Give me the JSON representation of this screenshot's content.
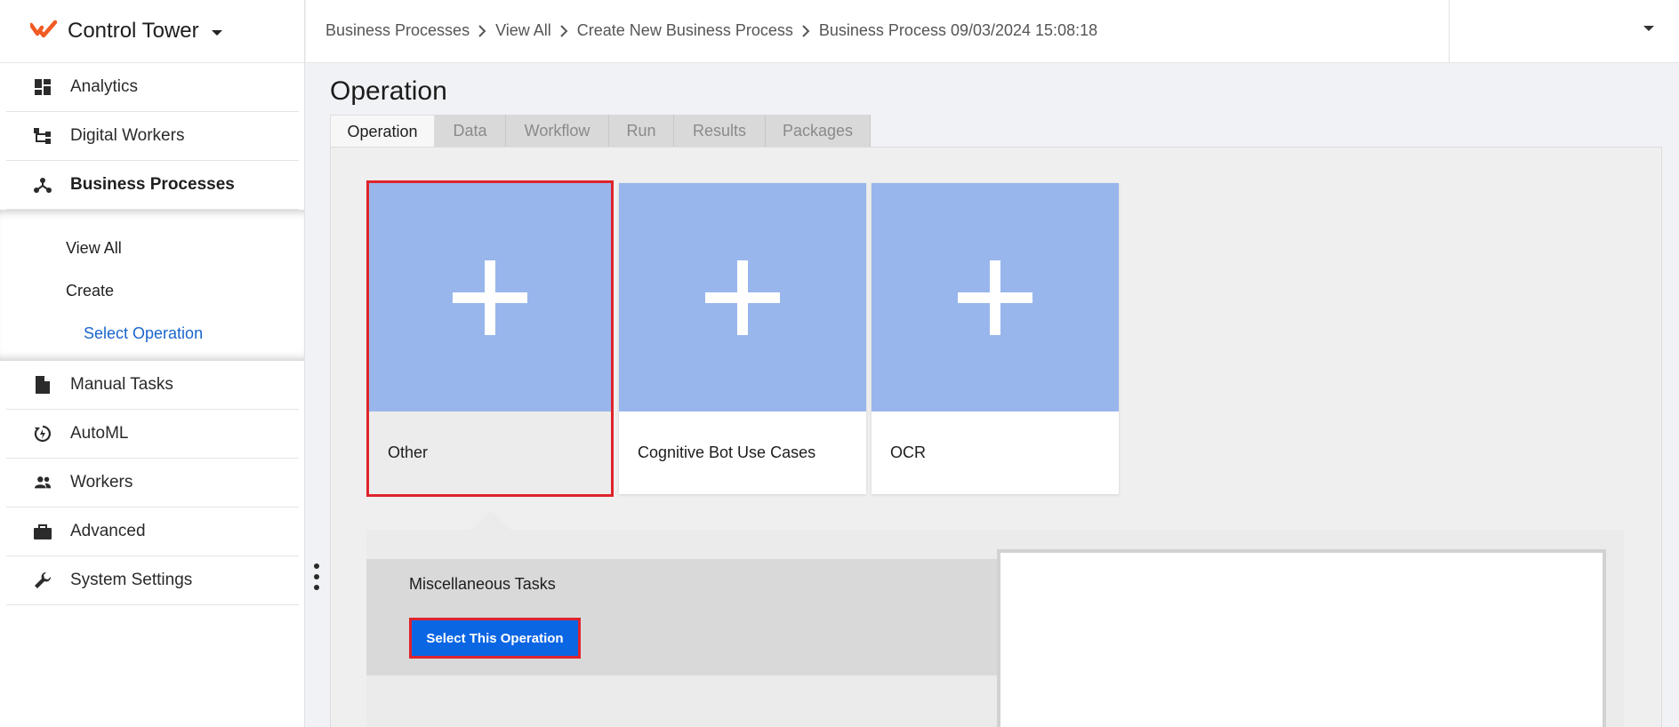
{
  "app": {
    "title": "Control Tower"
  },
  "sidebar": {
    "items": [
      {
        "label": "Analytics",
        "icon": "dashboard-icon"
      },
      {
        "label": "Digital Workers",
        "icon": "hierarchy-icon"
      },
      {
        "label": "Business Processes",
        "icon": "process-icon",
        "active": true
      },
      {
        "label": "Manual Tasks",
        "icon": "document-icon"
      },
      {
        "label": "AutoML",
        "icon": "automl-icon"
      },
      {
        "label": "Workers",
        "icon": "people-icon"
      },
      {
        "label": "Advanced",
        "icon": "briefcase-icon"
      },
      {
        "label": "System Settings",
        "icon": "wrench-icon"
      }
    ],
    "submenu": {
      "view_all": "View All",
      "create": "Create",
      "select_operation": "Select Operation"
    }
  },
  "breadcrumb": [
    "Business Processes",
    "View All",
    "Create New Business Process",
    "Business Process 09/03/2024 15:08:18"
  ],
  "page": {
    "title": "Operation"
  },
  "tabs": [
    "Operation",
    "Data",
    "Workflow",
    "Run",
    "Results",
    "Packages"
  ],
  "cards": [
    {
      "label": "Other",
      "selected": true
    },
    {
      "label": "Cognitive Bot Use Cases"
    },
    {
      "label": "OCR"
    }
  ],
  "operation": {
    "name": "Miscellaneous Tasks",
    "button": "Select This Operation"
  },
  "colors": {
    "accent": "#0b66e4",
    "card_art": "#99b6ec",
    "highlight": "#e0232b",
    "link": "#1a66cc",
    "logo": "#f05a23"
  }
}
